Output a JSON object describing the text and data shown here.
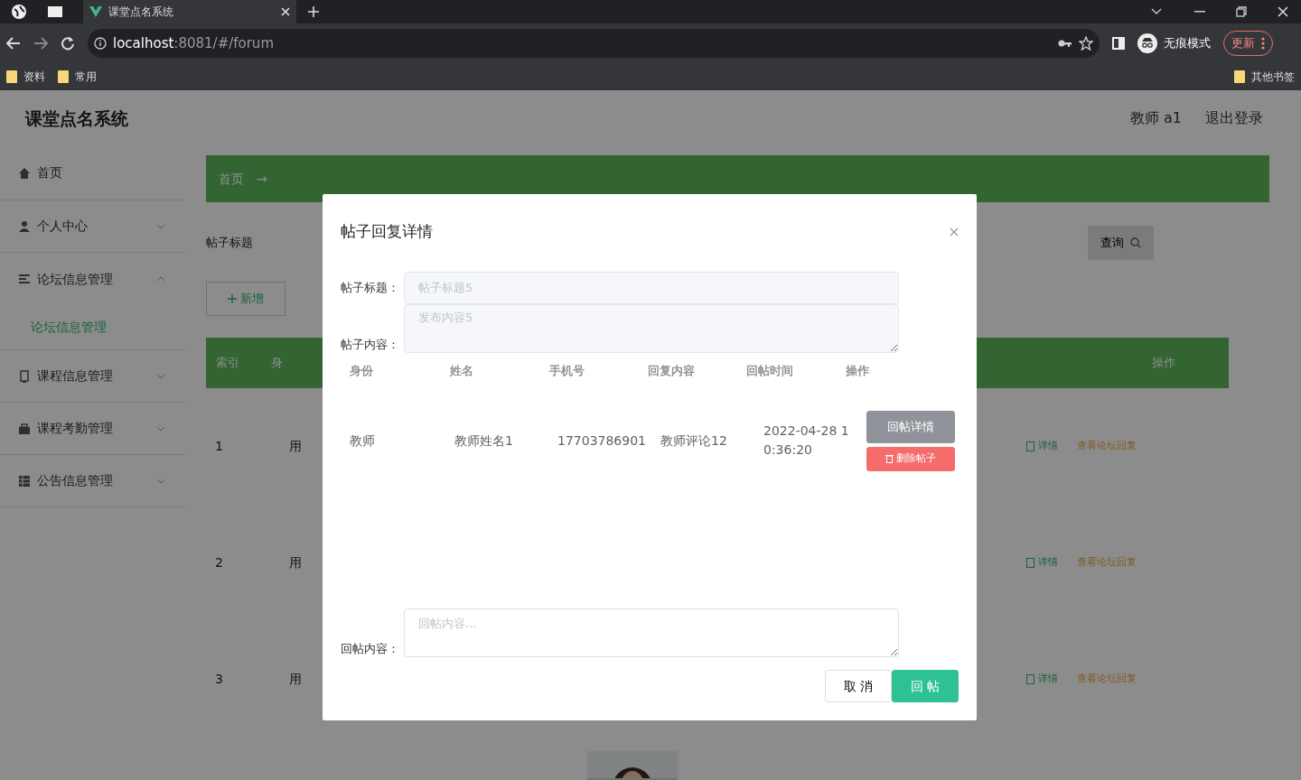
{
  "browser": {
    "tabs": [
      {
        "title": "课堂点名系统",
        "selected": true
      }
    ],
    "url_host": "localhost",
    "url_rest": ":8081/#/forum",
    "incognito": "无痕模式",
    "update": "更新",
    "bookmarks": [
      "资料",
      "常用"
    ],
    "other_bookmarks": "其他书签"
  },
  "app": {
    "title": "课堂点名系统",
    "user": "教师 a1",
    "logout": "退出登录",
    "sidebar": [
      {
        "label": "首页",
        "kind": "home"
      },
      {
        "label": "个人中心",
        "kind": "person",
        "expanded": false
      },
      {
        "label": "论坛信息管理",
        "kind": "list",
        "expanded": true,
        "children": [
          {
            "label": "论坛信息管理",
            "selected": true
          }
        ]
      },
      {
        "label": "课程信息管理",
        "kind": "phone",
        "expanded": false
      },
      {
        "label": "课程考勤管理",
        "kind": "bag",
        "expanded": false
      },
      {
        "label": "公告信息管理",
        "kind": "grid",
        "expanded": false
      }
    ],
    "breadcrumb": [
      "首页",
      "→"
    ],
    "search_label": "帖子标题",
    "query_button": "查询",
    "add_button": "新增",
    "table": {
      "columns": [
        "索引",
        "身",
        "操作"
      ],
      "rows": [
        {
          "cells": [
            "1",
            "用"
          ],
          "actions": [
            "详情",
            "查看论坛回复"
          ]
        },
        {
          "cells": [
            "2",
            "用"
          ],
          "actions": [
            "详情",
            "查看论坛回复"
          ]
        },
        {
          "cells": [
            "3",
            "用"
          ],
          "actions": [
            "详情",
            "查看论坛回复"
          ]
        }
      ]
    }
  },
  "modal": {
    "title": "帖子回复详情",
    "fields": [
      {
        "label": "帖子标题：",
        "value": "帖子标题5",
        "kind": "input",
        "disabled": true
      },
      {
        "label": "帖子内容：",
        "value": "发布内容5",
        "kind": "textarea",
        "disabled": true
      }
    ],
    "replies": {
      "columns": [
        "身份",
        "姓名",
        "手机号",
        "回复内容",
        "回帖时间",
        "操作"
      ],
      "rows": [
        {
          "cells": [
            "教师",
            "教师姓名1",
            "17703786901",
            "教师评论12",
            "2022-04-28 10:36:20"
          ],
          "actions": [
            "回帖详情",
            "删除帖子"
          ]
        }
      ]
    },
    "reply_field": {
      "label": "回帖内容：",
      "placeholder": "回帖内容..."
    },
    "buttons": [
      {
        "label": "取 消",
        "kind": "cancel"
      },
      {
        "label": "回 帖",
        "kind": "primary"
      }
    ]
  }
}
